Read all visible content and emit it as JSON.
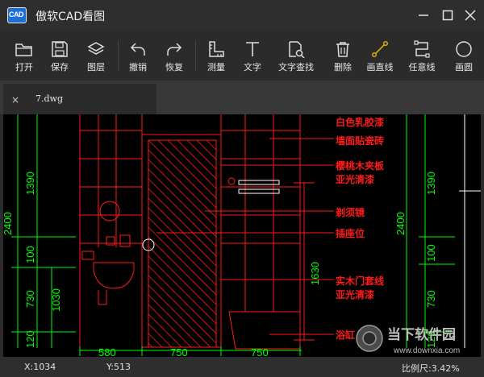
{
  "window": {
    "title": "傲软CAD看图",
    "logo_text": "CAD"
  },
  "toolbar": {
    "open": "打开",
    "save": "保存",
    "layers": "图层",
    "undo": "撤销",
    "redo": "恢复",
    "measure": "测量",
    "text": "文字",
    "find_text": "文字查找",
    "delete": "删除",
    "draw_line": "画直线",
    "any_line": "任意线",
    "circle": "画圆"
  },
  "tab": {
    "filename": "7.dwg",
    "close": "×"
  },
  "drawing": {
    "left_dims": [
      "2400",
      "1390",
      "100",
      "730",
      "1030",
      "120"
    ],
    "right_dims": [
      "2400",
      "1390",
      "100",
      "730",
      "120"
    ],
    "center_dim": "1630",
    "bottom_dims": [
      "580",
      "750",
      "750"
    ],
    "annotations": [
      "白色乳胶漆",
      "墙面贴瓷砖",
      "樱桃木夹板",
      "亚光清漆",
      "剃须镜",
      "插座位",
      "实木门套线",
      "亚光清漆",
      "浴缸"
    ]
  },
  "status": {
    "x": "X:1034",
    "y": "Y:513",
    "scale": "比例尺:3.42%"
  },
  "watermark": {
    "brand": "当下软件园",
    "url": "www.downxia.com"
  },
  "colors": {
    "background": "#2b2b2b",
    "canvas": "#000000",
    "cad_red": "#ff1a1a",
    "cad_green": "#00ff00",
    "cad_white": "#ffffff",
    "accent": "#e6b800"
  }
}
